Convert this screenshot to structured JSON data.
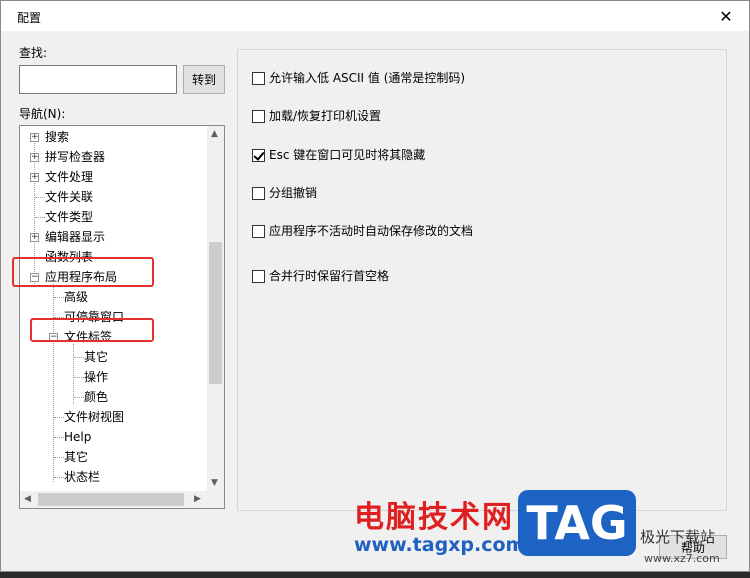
{
  "window": {
    "title": "配置",
    "close_glyph": "✕"
  },
  "search": {
    "label": "查找:",
    "value": "",
    "goto_label": "转到"
  },
  "nav": {
    "label": "导航(N):",
    "items": [
      {
        "label": "搜索",
        "expander": "+"
      },
      {
        "label": "拼写检查器",
        "expander": "+"
      },
      {
        "label": "文件处理",
        "expander": "+"
      },
      {
        "label": "文件关联",
        "expander": ""
      },
      {
        "label": "文件类型",
        "expander": ""
      },
      {
        "label": "编辑器显示",
        "expander": "+"
      },
      {
        "label": "函数列表",
        "expander": ""
      },
      {
        "label": "应用程序布局",
        "expander": "−"
      },
      {
        "label": "高级",
        "expander": ""
      },
      {
        "label": "可停靠窗口",
        "expander": ""
      },
      {
        "label": "文件标签",
        "expander": "−"
      },
      {
        "label": "其它",
        "expander": ""
      },
      {
        "label": "操作",
        "expander": ""
      },
      {
        "label": "颜色",
        "expander": ""
      },
      {
        "label": "文件树视图",
        "expander": ""
      },
      {
        "label": "Help",
        "expander": ""
      },
      {
        "label": "其它",
        "expander": ""
      },
      {
        "label": "状态栏",
        "expander": ""
      }
    ]
  },
  "options": [
    {
      "label": "允许输入低 ASCII 值 (通常是控制码)",
      "checked": false
    },
    {
      "label": "加载/恢复打印机设置",
      "checked": false
    },
    {
      "label": "Esc 键在窗口可见时将其隐藏",
      "checked": true
    },
    {
      "label": "分组撤销",
      "checked": false
    },
    {
      "label": "应用程序不活动时自动保存修改的文档",
      "checked": false
    },
    {
      "label": "合并行时保留行首空格",
      "checked": false
    }
  ],
  "help_label": "帮助",
  "watermark": {
    "title": "电脑技术网",
    "url": "www.tagxp.com",
    "tag": "TAG",
    "site": "极光下载站",
    "site_url": "www.xz7.com"
  },
  "colors": {
    "highlight": "#e53030",
    "watermark_red": "#e02020",
    "watermark_blue": "#1d63c4"
  }
}
